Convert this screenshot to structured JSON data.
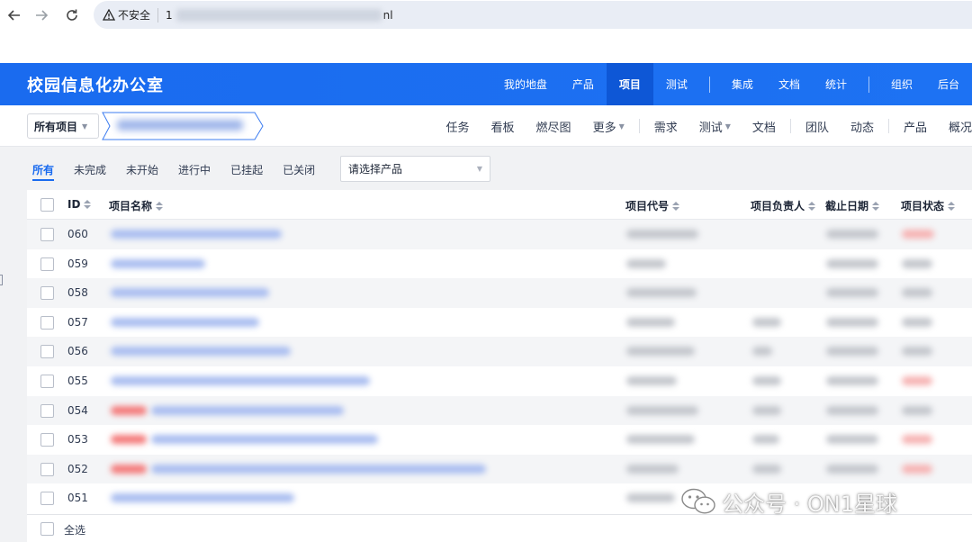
{
  "browser": {
    "insecure_label": "不安全",
    "url_prefix": "1",
    "url_suffix": "nl"
  },
  "header": {
    "title": "校园信息化办公室",
    "nav": [
      "我的地盘",
      "产品",
      "项目",
      "测试",
      "集成",
      "文档",
      "统计",
      "组织",
      "后台"
    ],
    "active": "项目"
  },
  "subheader": {
    "project_select": "所有项目",
    "nav": [
      "任务",
      "看板",
      "燃尽图",
      "更多",
      "需求",
      "测试",
      "文档",
      "团队",
      "动态",
      "产品",
      "概况"
    ]
  },
  "filters": {
    "tabs": [
      "所有",
      "未完成",
      "未开始",
      "进行中",
      "已挂起",
      "已关闭"
    ],
    "active": "所有",
    "product_placeholder": "请选择产品"
  },
  "table": {
    "columns": [
      "ID",
      "项目名称",
      "项目代号",
      "项目负责人",
      "截止日期",
      "项目状态"
    ],
    "rows": [
      {
        "id": "060"
      },
      {
        "id": "059"
      },
      {
        "id": "058"
      },
      {
        "id": "057"
      },
      {
        "id": "056"
      },
      {
        "id": "055"
      },
      {
        "id": "054"
      },
      {
        "id": "053"
      },
      {
        "id": "052"
      },
      {
        "id": "051"
      }
    ],
    "select_all": "全选"
  },
  "watermark": "公众号 · ON1星球",
  "colors": {
    "brand": "#1a6bef",
    "active_nav": "#0e57d6"
  }
}
